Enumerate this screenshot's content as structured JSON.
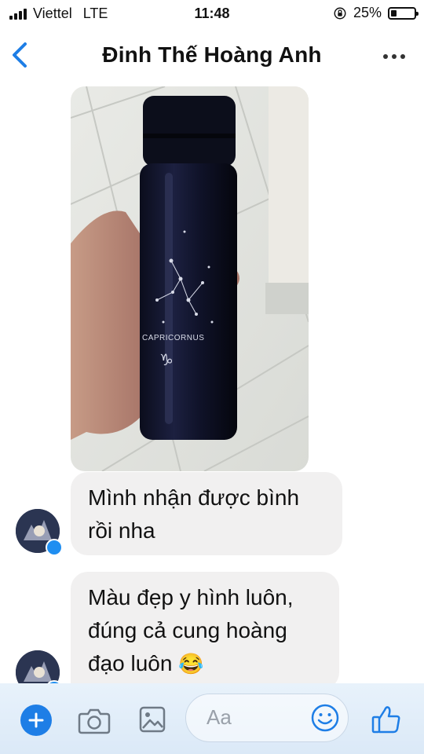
{
  "status_bar": {
    "carrier": "Viettel",
    "network": "LTE",
    "time": "11:48",
    "battery_text": "25%",
    "battery_level": 0.25
  },
  "header": {
    "title": "Đinh Thế Hoàng Anh",
    "back_icon": "chevron-left-icon",
    "more_icon": "more-horizontal-icon"
  },
  "messages": [
    {
      "type": "photo",
      "description_icon": "thermos-bottle-photo",
      "bottle_text": "CAPRICORNUS"
    },
    {
      "type": "text",
      "lines": [
        "Mình nhận được bình",
        "rồi nha"
      ]
    },
    {
      "type": "text",
      "lines": [
        "Màu đẹp y hình luôn,",
        "đúng cả cung hoàng",
        "đạo luôn"
      ],
      "emoji": "😂"
    }
  ],
  "composer": {
    "placeholder": "Aa",
    "icons": [
      "plus-icon",
      "camera-icon",
      "image-icon",
      "smiley-icon",
      "thumbs-up-icon"
    ]
  },
  "colors": {
    "accent": "#1e7ee6",
    "bubble": "#f1f0f0"
  }
}
